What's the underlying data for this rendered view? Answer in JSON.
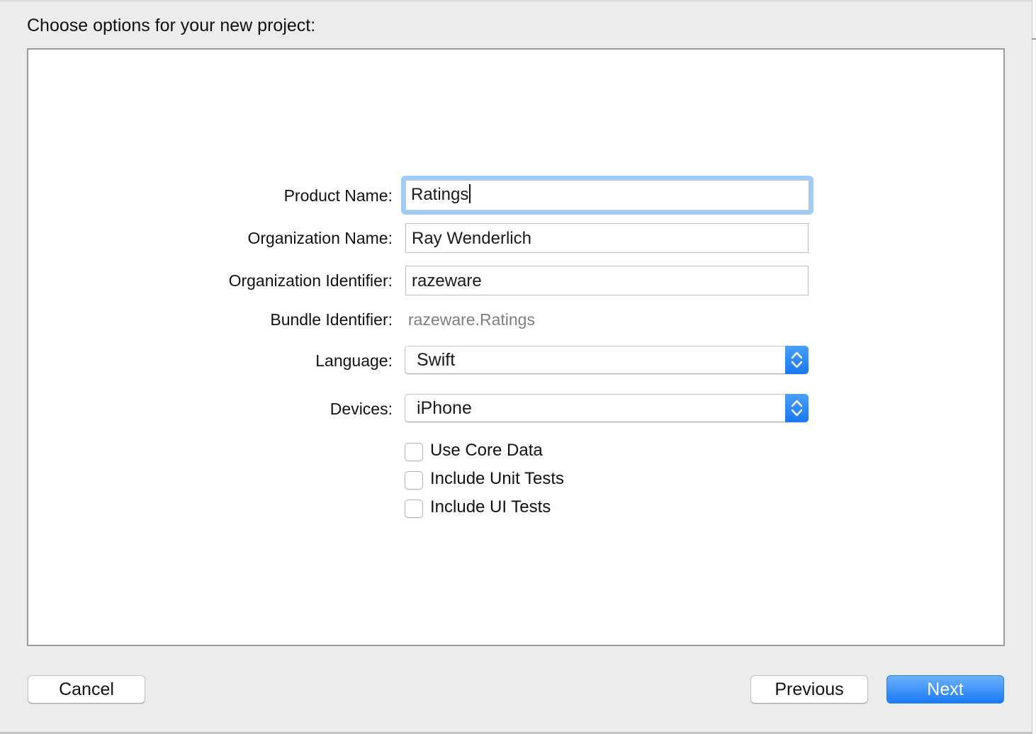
{
  "dialog": {
    "heading": "Choose options for your new project:"
  },
  "form": {
    "product_name": {
      "label": "Product Name:",
      "value": "Ratings"
    },
    "organization_name": {
      "label": "Organization Name:",
      "value": "Ray Wenderlich"
    },
    "organization_identifier": {
      "label": "Organization Identifier:",
      "value": "razeware"
    },
    "bundle_identifier": {
      "label": "Bundle Identifier:",
      "value": "razeware.Ratings"
    },
    "language": {
      "label": "Language:",
      "selected": "Swift"
    },
    "devices": {
      "label": "Devices:",
      "selected": "iPhone"
    },
    "checkboxes": [
      {
        "label": "Use Core Data",
        "checked": false
      },
      {
        "label": "Include Unit Tests",
        "checked": false
      },
      {
        "label": "Include UI Tests",
        "checked": false
      }
    ]
  },
  "buttons": {
    "cancel": "Cancel",
    "previous": "Previous",
    "next": "Next"
  },
  "colors": {
    "accent": "#1a7af5",
    "focus_ring": "#9fcbf7",
    "muted_text": "#7e7e7e"
  }
}
